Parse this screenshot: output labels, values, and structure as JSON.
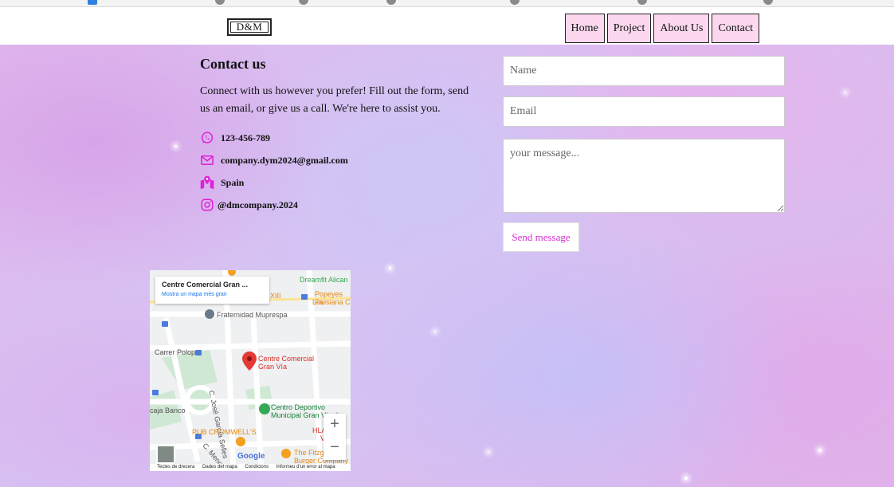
{
  "logo": {
    "text": "D&M"
  },
  "nav": {
    "items": [
      "Home",
      "Project",
      "About Us",
      "Contact"
    ]
  },
  "contact": {
    "title": "Contact us",
    "description": "Connect with us however you prefer! Fill out the form, send us an email, or give us a call. We're here to assist you.",
    "phone": "123-456-789",
    "email": "company.dym2024@gmail.com",
    "location": "Spain",
    "instagram": "@dmcompany.2024"
  },
  "form": {
    "name_placeholder": "Name",
    "email_placeholder": "Email",
    "message_placeholder": "your message...",
    "send_label": "Send message"
  },
  "map": {
    "card_title": "Centre Comercial Gran ...",
    "card_link": "Mostra un mapa més gran",
    "labels": {
      "dreamfit": "Dreamfit Alican",
      "popeyes": "Popeyes Fa",
      "popeyes2": "Louisiana C",
      "xiii": "XIII",
      "fraternidad": "Fraternidad Muprespa",
      "carrer_polop": "Carrer Polop",
      "centre1": "Centre Comercial",
      "centre2": "Gran Vía",
      "jose": "C. José García Selles",
      "caja": "caja Banco",
      "centro1": "Centro Deportivo",
      "centro2": "Municipal Gran Vía de",
      "pub": "PUB CROMWELL'S",
      "hla1": "HLA",
      "hla2": "V",
      "fitzg1": "The Fitzg",
      "fitzg2": "Burger Company",
      "menor": "C. Menor",
      "google": "Google",
      "footer": [
        "Tecles de drecera",
        "Dades del mapa",
        "Condicions",
        "Informeu d'un error al mapa"
      ]
    },
    "zoom_in": "+",
    "zoom_out": "−"
  },
  "colors": {
    "accent": "#d42fd0",
    "nav_bg": "#fbd8ee",
    "icon": "#e01fd7"
  }
}
